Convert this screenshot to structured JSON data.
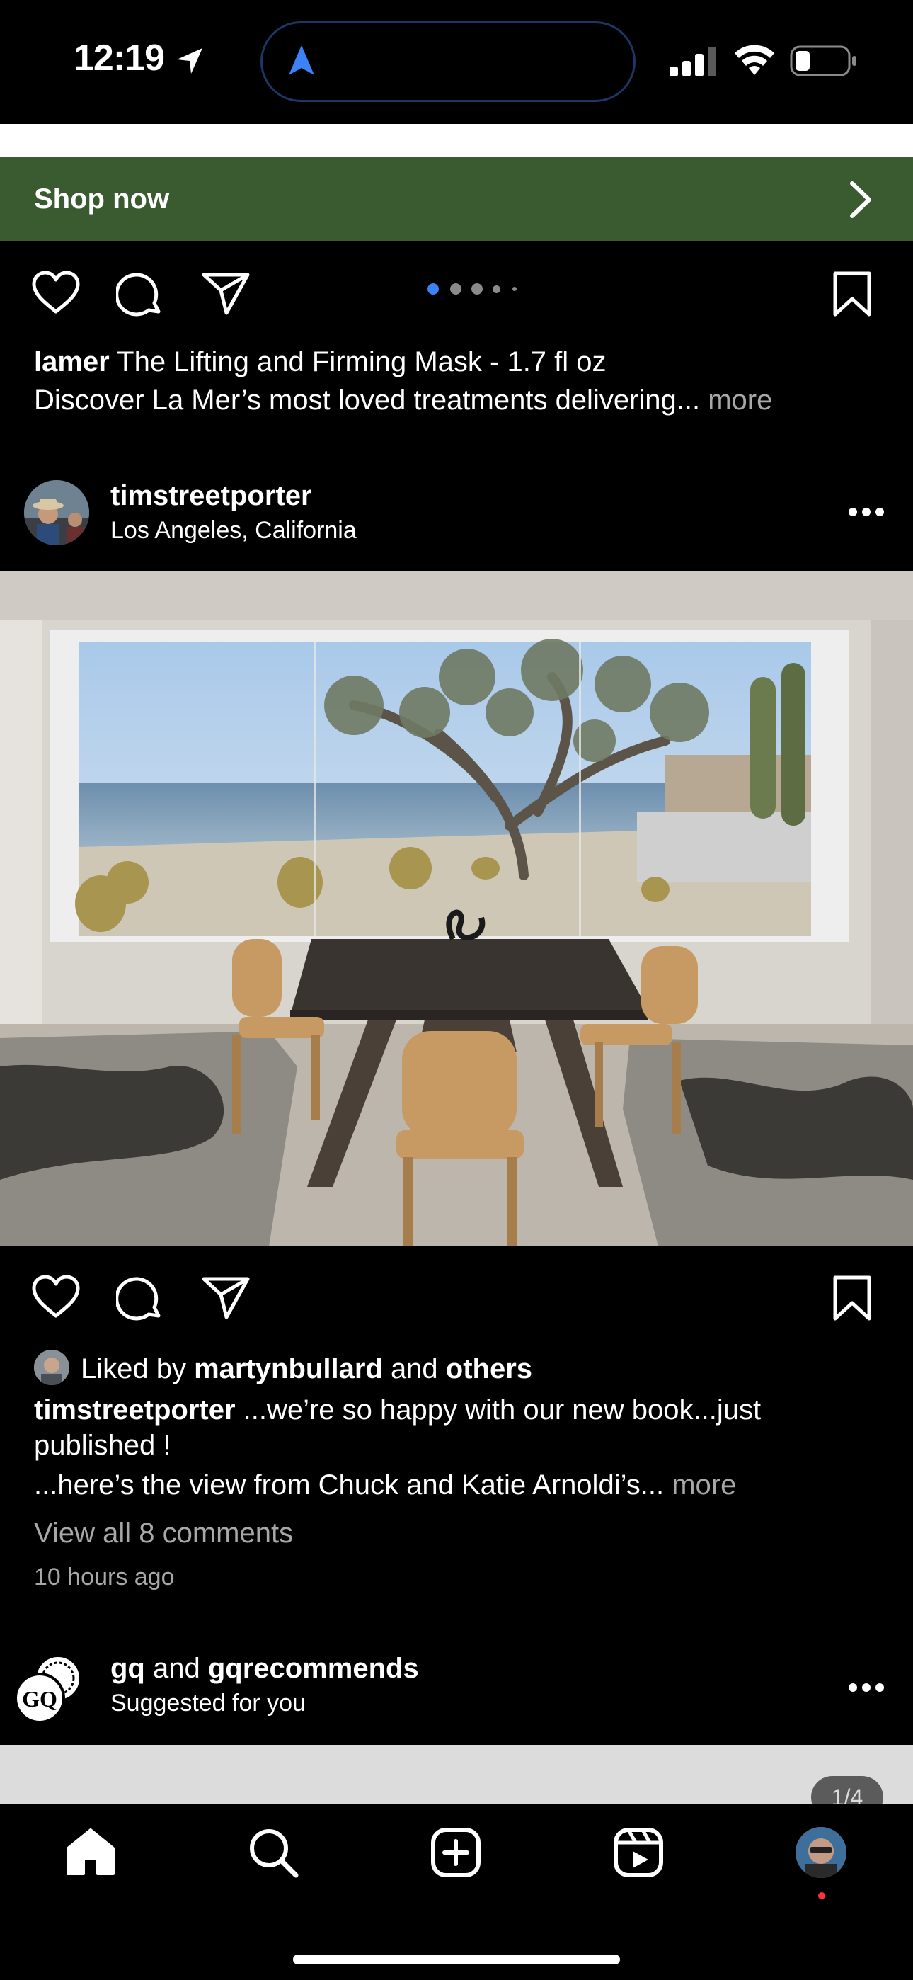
{
  "status_bar": {
    "time": "12:19"
  },
  "ad": {
    "cta_label": "Shop now",
    "carousel_dots": 5,
    "carousel_active": 0,
    "caption_user": "lamer",
    "caption_text": " The Lifting and Firming Mask - 1.7 fl oz",
    "caption_line2": "Discover La Mer’s most loved treatments delivering...",
    "more_label": " more",
    "accent_color": "#395b2f"
  },
  "post": {
    "username": "timstreetporter",
    "location": "Los Angeles, California",
    "liked_by_prefix": "Liked by ",
    "liked_by_user": "martynbullard",
    "liked_by_and": " and ",
    "liked_by_others": "others",
    "caption_user": "timstreetporter",
    "caption_line1": " ...we’re so happy with our new book...just",
    "caption_line2": "published !",
    "caption_line3": "...here’s the view from Chuck and Katie Arnoldi’s...",
    "more_label": " more",
    "view_comments": "View all 8 comments",
    "timestamp": "10 hours ago"
  },
  "suggested": {
    "user1": "gq",
    "and": " and ",
    "user2": "gqrecommends",
    "subtitle": "Suggested for you",
    "count_badge": "1/4"
  },
  "tabs": [
    {
      "icon": "home-icon",
      "active": true
    },
    {
      "icon": "search-icon"
    },
    {
      "icon": "create-icon"
    },
    {
      "icon": "reels-icon"
    },
    {
      "icon": "profile-avatar",
      "notification_dot": true
    }
  ]
}
